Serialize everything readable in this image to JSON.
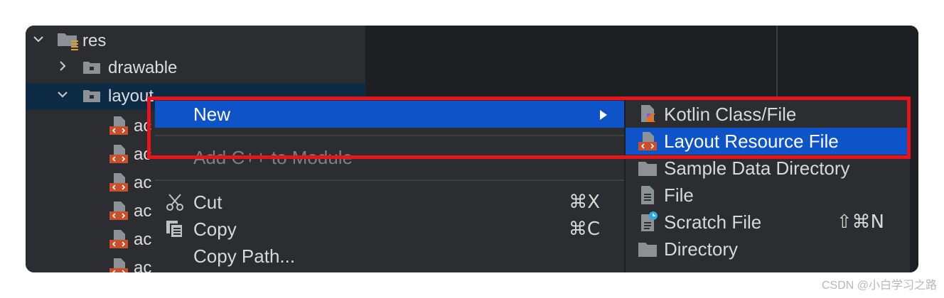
{
  "tree": {
    "items": [
      {
        "label": "res",
        "expanded": true
      },
      {
        "label": "drawable",
        "expanded": false
      },
      {
        "label": "layout",
        "expanded": true
      },
      {
        "label": "ac"
      },
      {
        "label": "ac"
      },
      {
        "label": "ac"
      },
      {
        "label": "ac"
      },
      {
        "label": "ac"
      },
      {
        "label": "ac"
      }
    ]
  },
  "menu": {
    "new": "New",
    "add_cpp": "Add C++ to Module",
    "cut": "Cut",
    "cut_shortcut": "⌘X",
    "copy": "Copy",
    "copy_shortcut": "⌘C",
    "copy_path": "Copy Path..."
  },
  "submenu": {
    "kotlin": "Kotlin Class/File",
    "layout_resource": "Layout Resource File",
    "sample_data": "Sample Data Directory",
    "file": "File",
    "scratch": "Scratch File",
    "scratch_shortcut": "⇧⌘N",
    "directory": "Directory"
  },
  "icons": [
    "chevron-down-icon",
    "chevron-right-icon",
    "folder-icon",
    "layout-xml-icon",
    "scissors-icon",
    "copy-icon",
    "kotlin-icon",
    "file-icon",
    "scratch-file-icon",
    "directory-icon"
  ],
  "colors": {
    "highlight": "#0e54c8",
    "annotation": "#e8141a",
    "xml_icon": "#c9502c"
  },
  "watermark": "CSDN @小白学习之路"
}
